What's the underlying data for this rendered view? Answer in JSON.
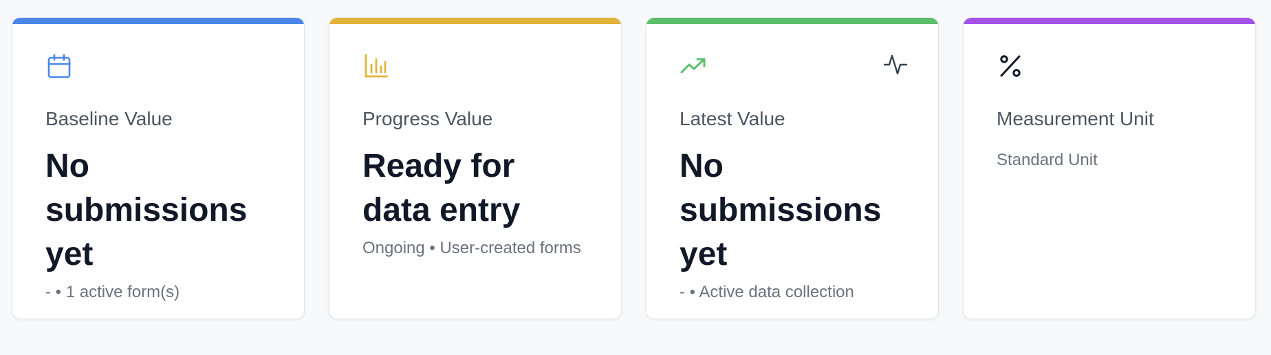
{
  "cards": [
    {
      "accent_color": "#4a86e8",
      "icon": "calendar-icon",
      "label": "Baseline Value",
      "value": "No submissions yet",
      "subtext": "- • 1 active form(s)"
    },
    {
      "accent_color": "#e0b43a",
      "icon": "bar-chart-icon",
      "label": "Progress Value",
      "value": "Ready for data entry",
      "subtext": "Ongoing • User-created forms"
    },
    {
      "accent_color": "#5cbf6a",
      "icon": "trending-up-icon",
      "secondary_icon": "activity-icon",
      "label": "Latest Value",
      "value": "No submissions yet",
      "subtext": "- • Active data collection"
    },
    {
      "accent_color": "#a452e8",
      "icon": "percent-icon",
      "label": "Measurement Unit",
      "subtext": "Standard Unit"
    }
  ]
}
